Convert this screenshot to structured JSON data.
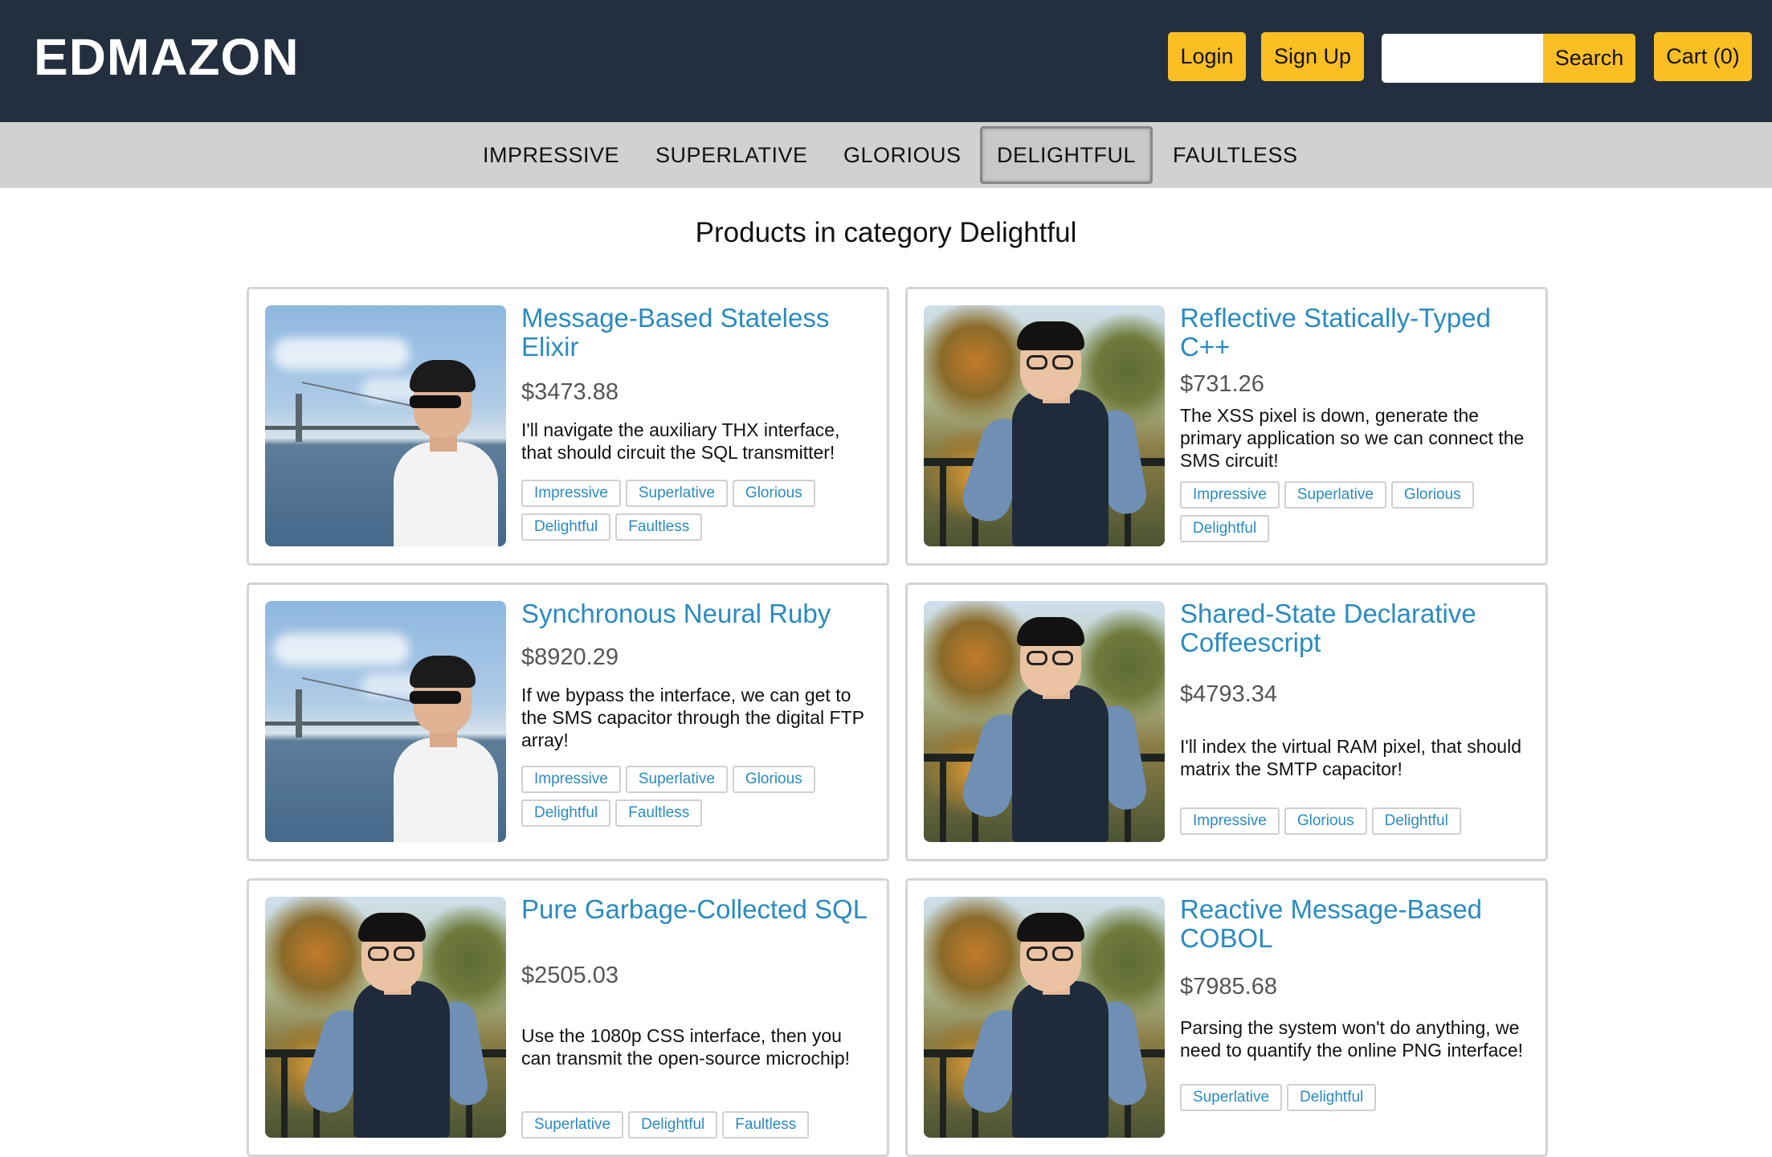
{
  "header": {
    "logo": "EDMAZON",
    "login_label": "Login",
    "signup_label": "Sign Up",
    "search_value": "",
    "search_button_label": "Search",
    "cart_label": "Cart (0)",
    "colors": {
      "background": "#232f3e",
      "button": "#fbbf24"
    }
  },
  "categories": [
    {
      "label": "IMPRESSIVE",
      "active": false
    },
    {
      "label": "SUPERLATIVE",
      "active": false
    },
    {
      "label": "GLORIOUS",
      "active": false
    },
    {
      "label": "DELIGHTFUL",
      "active": true
    },
    {
      "label": "FAULTLESS",
      "active": false
    }
  ],
  "main": {
    "heading": "Products in category Delightful"
  },
  "products": [
    {
      "title": "Message-Based Stateless Elixir",
      "price": "$3473.88",
      "description": "I'll navigate the auxiliary THX interface, that should circuit the SQL transmitter!",
      "tags": [
        "Impressive",
        "Superlative",
        "Glorious",
        "Delightful",
        "Faultless"
      ],
      "image": "bridge-waterfront-photo"
    },
    {
      "title": "Reflective Statically-Typed C++",
      "price": "$731.26",
      "description": "The XSS pixel is down, generate the primary application so we can connect the SMS circuit!",
      "tags": [
        "Impressive",
        "Superlative",
        "Glorious",
        "Delightful"
      ],
      "image": "autumn-balcony-photo"
    },
    {
      "title": "Synchronous Neural Ruby",
      "price": "$8920.29",
      "description": "If we bypass the interface, we can get to the SMS capacitor through the digital FTP array!",
      "tags": [
        "Impressive",
        "Superlative",
        "Glorious",
        "Delightful",
        "Faultless"
      ],
      "image": "bridge-waterfront-photo"
    },
    {
      "title": "Shared-State Declarative Coffeescript",
      "price": "$4793.34",
      "description": "I'll index the virtual RAM pixel, that should matrix the SMTP capacitor!",
      "tags": [
        "Impressive",
        "Glorious",
        "Delightful"
      ],
      "image": "autumn-balcony-photo"
    },
    {
      "title": "Pure Garbage-Collected SQL",
      "price": "$2505.03",
      "description": "Use the 1080p CSS interface, then you can transmit the open-source microchip!",
      "tags": [
        "Superlative",
        "Delightful",
        "Faultless"
      ],
      "image": "autumn-balcony-photo"
    },
    {
      "title": "Reactive Message-Based COBOL",
      "price": "$7985.68",
      "description": "Parsing the system won't do anything, we need to quantify the online PNG interface!",
      "tags": [
        "Superlative",
        "Delightful"
      ],
      "image": "autumn-balcony-photo"
    }
  ]
}
